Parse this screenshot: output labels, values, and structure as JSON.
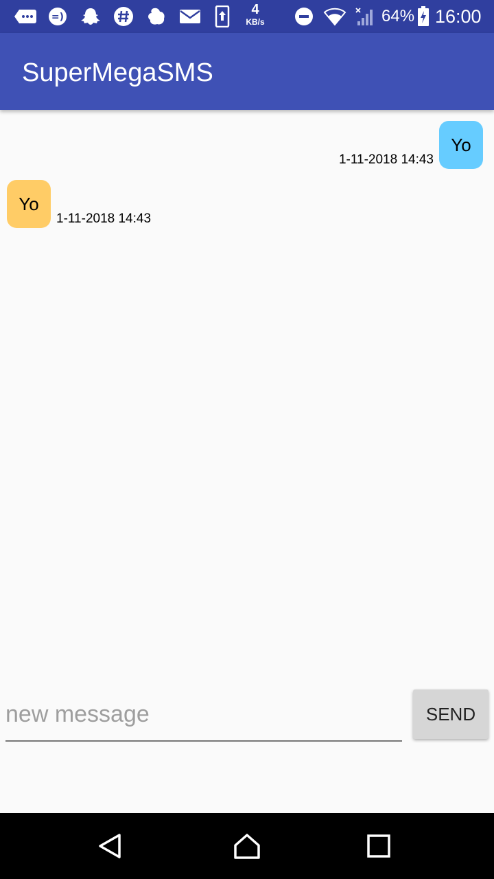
{
  "status_bar": {
    "icons": [
      "message-icon",
      "smiley-icon",
      "snapchat-icon",
      "slack-icon",
      "app-icon",
      "mail-icon",
      "upload-icon"
    ],
    "net_speed_value": "4",
    "net_speed_unit": "KB/s",
    "right_icons": [
      "do-not-disturb-icon",
      "wifi-icon",
      "signal-icon",
      "battery-charging-icon"
    ],
    "battery": "64%",
    "time": "16:00"
  },
  "app_bar": {
    "title": "SuperMegaSMS"
  },
  "messages": [
    {
      "text": "Yo",
      "timestamp": "1-11-2018 14:43",
      "direction": "outgoing",
      "color": "#66ccff"
    },
    {
      "text": "Yo",
      "timestamp": "1-11-2018 14:43",
      "direction": "incoming",
      "color": "#ffcc66"
    }
  ],
  "composer": {
    "placeholder": "new message",
    "value": "",
    "send_label": "SEND"
  },
  "nav": {
    "buttons": [
      "back-icon",
      "home-icon",
      "recents-icon"
    ]
  },
  "colors": {
    "status_bar": "#303f9f",
    "app_bar": "#3f51b5",
    "background": "#fafafa",
    "send_button": "#d6d6d6"
  }
}
